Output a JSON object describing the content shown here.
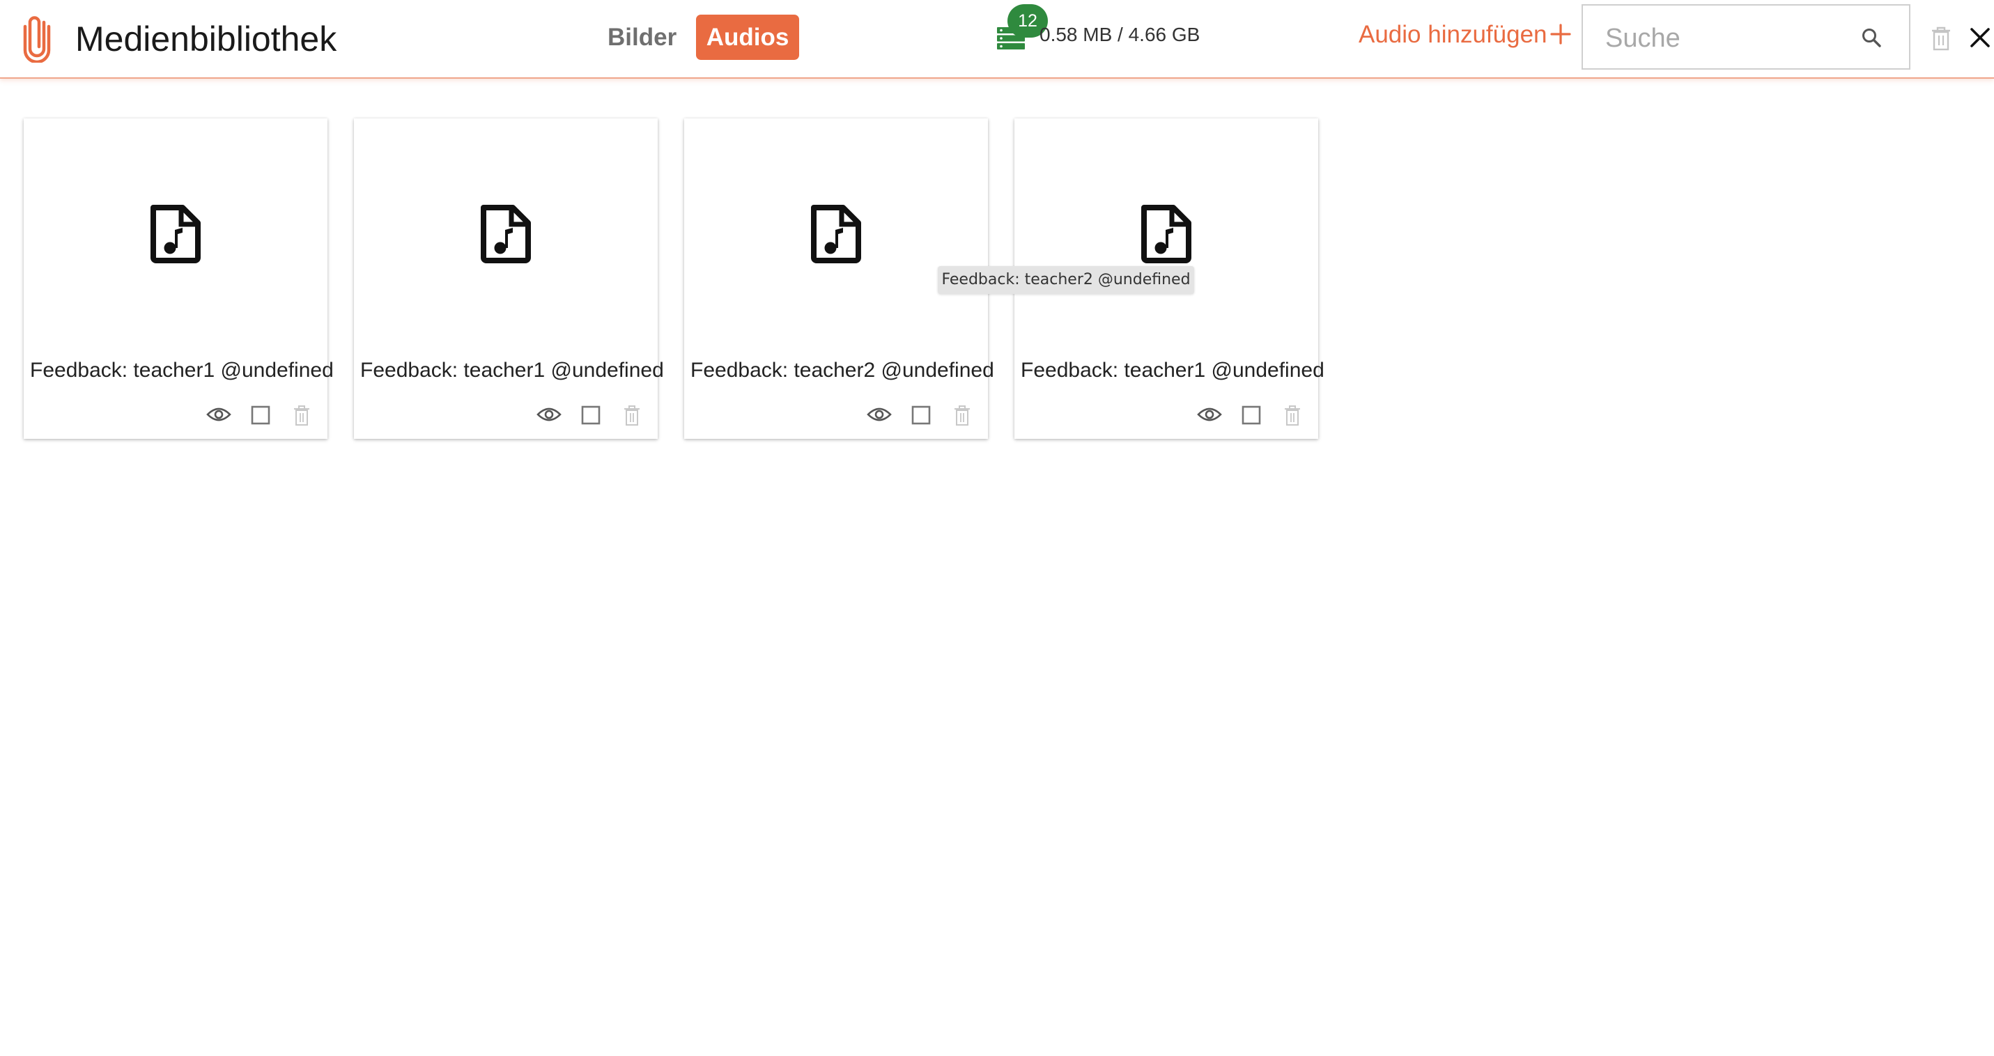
{
  "header": {
    "title": "Medienbibliothek",
    "tabs": [
      {
        "label": "Bilder",
        "active": false
      },
      {
        "label": "Audios",
        "active": true
      }
    ],
    "storage": {
      "badge_count": "12",
      "usage_text": "0.58 MB / 4.66 GB"
    },
    "add_label": "Audio hinzufügen",
    "search": {
      "placeholder": "Suche",
      "value": ""
    }
  },
  "colors": {
    "accent": "#e96b41",
    "badge": "#2f8a3e"
  },
  "icons": {
    "logo": "paperclip-icon",
    "storage": "server-stack-icon",
    "add": "plus-icon",
    "search": "search-icon",
    "delete": "trash-icon",
    "close": "close-icon",
    "file": "audio-file-icon",
    "preview": "eye-icon",
    "select": "checkbox"
  },
  "cards": [
    {
      "title": "Feedback: teacher1 @undefined"
    },
    {
      "title": "Feedback: teacher1 @undefined"
    },
    {
      "title": "Feedback: teacher2 @undefined"
    },
    {
      "title": "Feedback: teacher1 @undefined"
    }
  ],
  "tooltip": {
    "text": "Feedback: teacher2 @undefined"
  }
}
